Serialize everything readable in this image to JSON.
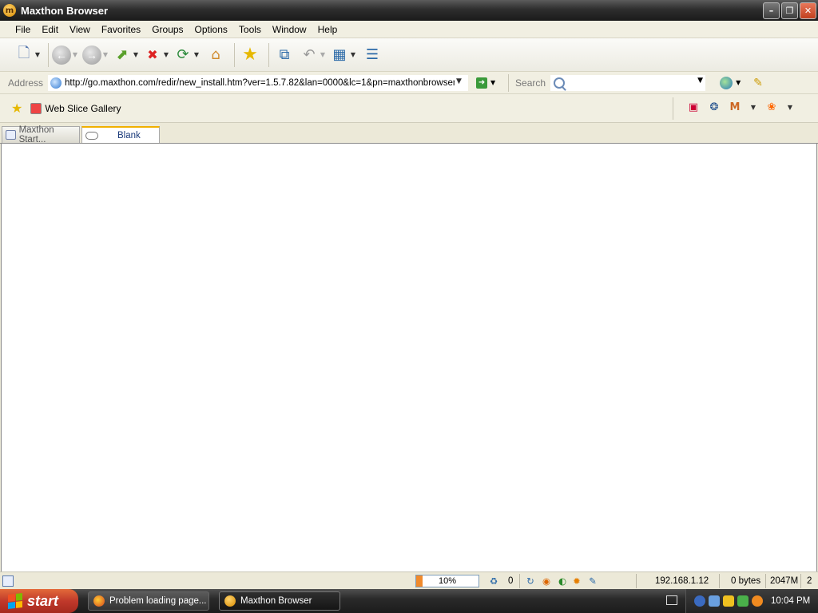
{
  "window": {
    "title": "Maxthon Browser"
  },
  "menu": [
    "File",
    "Edit",
    "View",
    "Favorites",
    "Groups",
    "Options",
    "Tools",
    "Window",
    "Help"
  ],
  "address": {
    "label": "Address",
    "url": "http://go.maxthon.com/redir/new_install.htm?ver=1.5.7.82&lan=0000&lc=1&pn=maxthonbrowser"
  },
  "search": {
    "label": "Search",
    "value": ""
  },
  "favorites": {
    "items": [
      {
        "label": "Web Slice Gallery"
      }
    ]
  },
  "tabs": [
    {
      "label": "Maxthon Start...",
      "active": false
    },
    {
      "label": "Blank",
      "active": true
    }
  ],
  "status": {
    "progress_text": "10%",
    "progress_value": 0.1,
    "blocked_count": "0",
    "ip": "192.168.1.12",
    "bytes": "0 bytes",
    "memory": "2047M",
    "extra": "2"
  },
  "taskbar": {
    "start_label": "start",
    "items": [
      {
        "label": "Problem loading page...",
        "active": false
      },
      {
        "label": "Maxthon Browser",
        "active": true
      }
    ],
    "clock": "10:04 PM"
  },
  "colors": {
    "titlebar": "#2e2e2e",
    "start": "#c0392b",
    "progress_fill": "#f08a2c",
    "tab_active_accent": "#f0b000"
  }
}
